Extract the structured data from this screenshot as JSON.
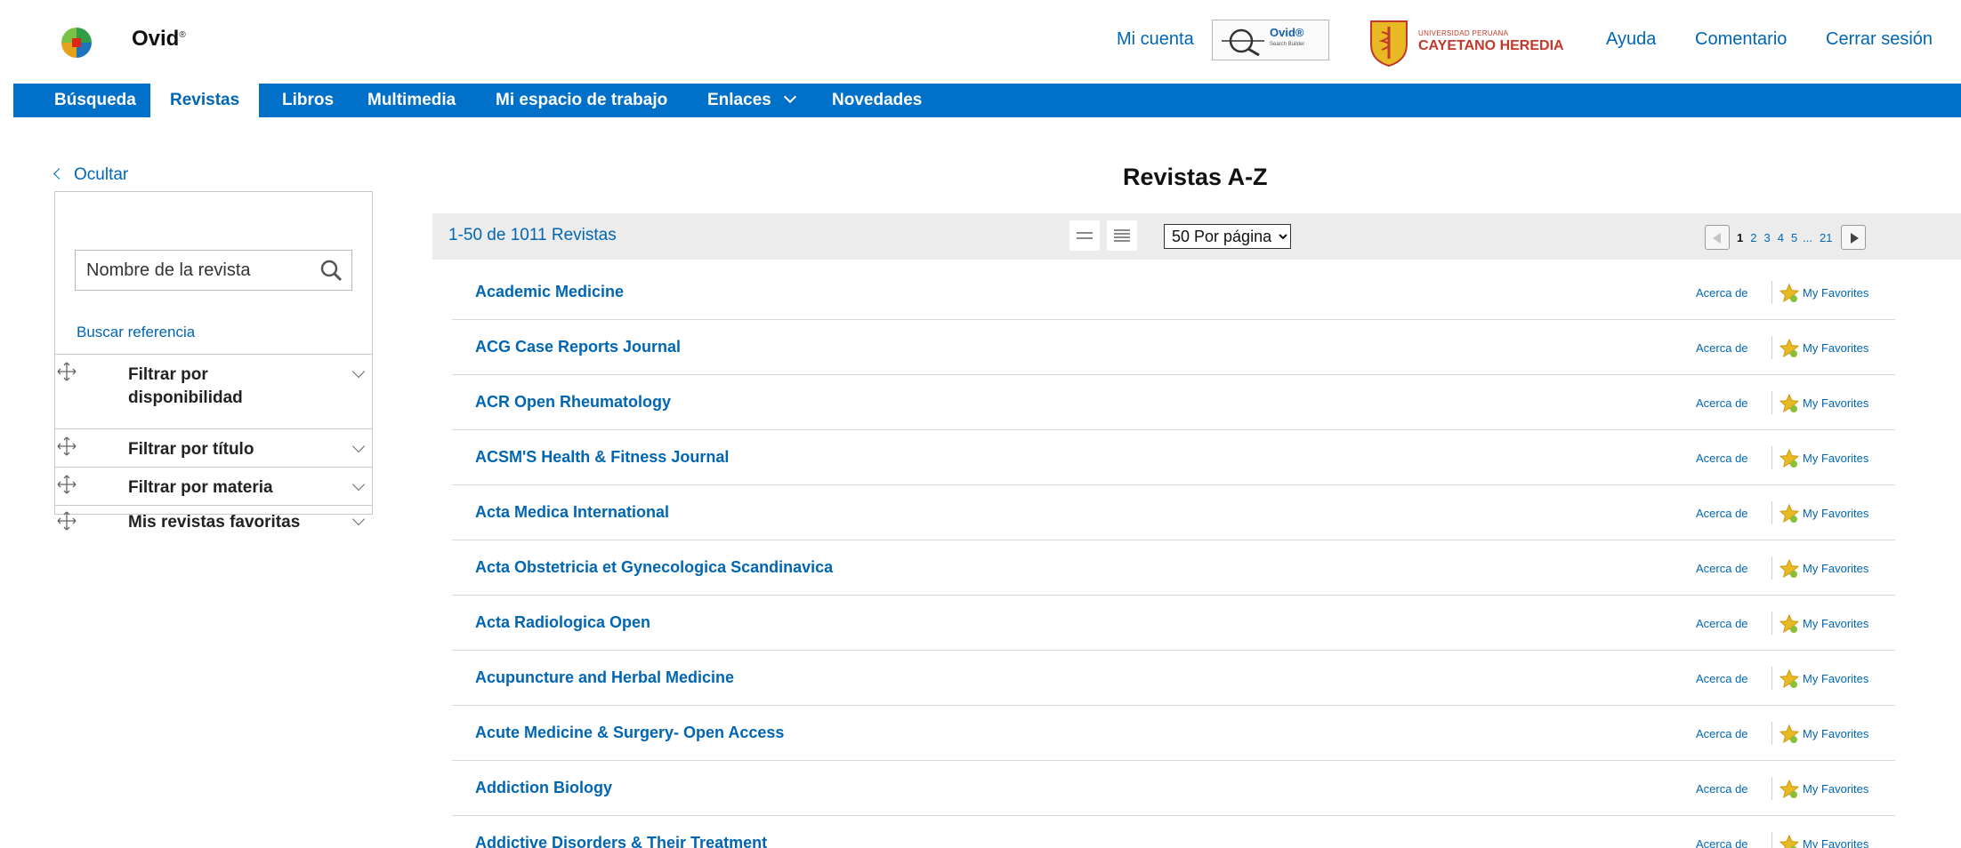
{
  "header": {
    "brand": "Ovid",
    "brand_mark": "®",
    "my_account": "Mi cuenta",
    "search_builder_logo": {
      "title": "Ovid®",
      "subtitle": "Search Builder"
    },
    "institution": {
      "line1": "UNIVERSIDAD PERUANA",
      "line2": "CAYETANO HEREDIA"
    },
    "help": "Ayuda",
    "feedback": "Comentario",
    "logout": "Cerrar sesión"
  },
  "nav": {
    "items": [
      {
        "label": "Búsqueda",
        "active": false
      },
      {
        "label": "Revistas",
        "active": true
      },
      {
        "label": "Libros",
        "active": false
      },
      {
        "label": "Multimedia",
        "active": false
      },
      {
        "label": "Mi espacio de trabajo",
        "active": false
      },
      {
        "label": "Enlaces",
        "active": false,
        "dropdown": true
      },
      {
        "label": "Novedades",
        "active": false
      }
    ]
  },
  "sidebar": {
    "hide_label": "Ocultar",
    "search_placeholder": "Nombre de la revista",
    "cite_link": "Buscar referencia",
    "filters": [
      {
        "label": "Filtrar por disponibilidad"
      },
      {
        "label": "Filtrar por título"
      },
      {
        "label": "Filtrar por materia"
      },
      {
        "label": "Mis revistas favoritas"
      }
    ]
  },
  "main": {
    "title": "Revistas A-Z",
    "results_count": "1-50 de 1011 Revistas",
    "per_page": {
      "selected": "50  Por página",
      "options": [
        "50  Por página"
      ]
    },
    "pagination": {
      "current": "1",
      "pages": [
        "2",
        "3",
        "4",
        "5"
      ],
      "ellipsis": "...",
      "last": "21"
    },
    "about_label": "Acerca de",
    "favorites_label": "My Favorites",
    "journals": [
      "Academic Medicine",
      "ACG Case Reports Journal",
      "ACR Open Rheumatology",
      "ACSM'S Health & Fitness Journal",
      "Acta Medica International",
      "Acta Obstetricia et Gynecologica Scandinavica",
      "Acta Radiologica Open",
      "Acupuncture and Herbal Medicine",
      "Acute Medicine & Surgery- Open Access",
      "Addiction Biology",
      "Addictive Disorders & Their Treatment"
    ]
  },
  "colors": {
    "accent": "#0070c9",
    "link": "#0066b3",
    "institution_red": "#c0392b",
    "star": "#e8b923"
  },
  "icons": [
    "wolters-kluwer-globe-icon",
    "magnifier-icon",
    "shield-crest-icon",
    "search-icon",
    "move-icon",
    "chevron-down-icon",
    "chevron-left-icon",
    "star-icon",
    "list-compact-icon",
    "list-expanded-icon"
  ]
}
